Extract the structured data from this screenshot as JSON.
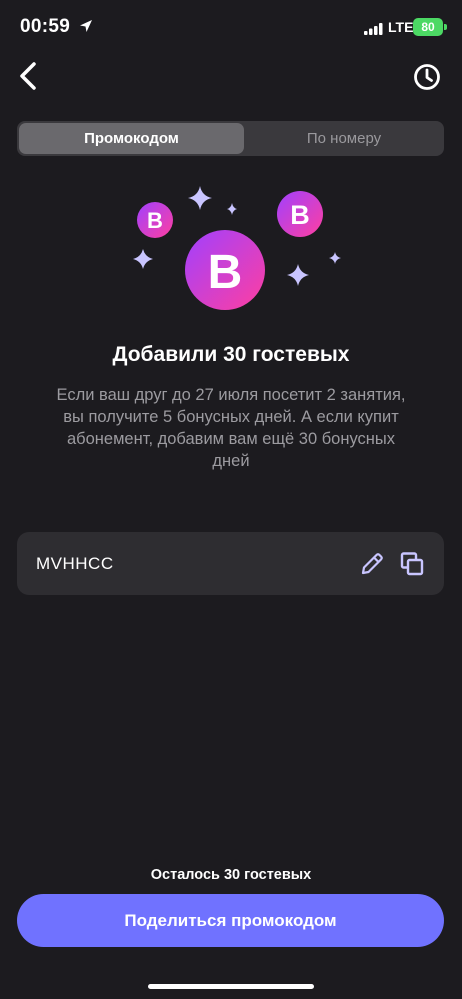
{
  "status_bar": {
    "time": "00:59",
    "network": "LTE",
    "battery": "80"
  },
  "tabs": [
    {
      "label": "Промокодом",
      "active": true
    },
    {
      "label": "По номеру",
      "active": false
    }
  ],
  "hero": {
    "badge_letter": "B"
  },
  "title": "Добавили 30 гостевых",
  "description": "Если ваш друг до 27 июля посетит 2 занятия, вы получите 5 бонусных дней. А если купит абонемент, добавим вам ещё 30 бонусных дней",
  "promo": {
    "code": "MVHHCC"
  },
  "remaining_text": "Осталось 30 гостевых",
  "share_button_label": "Поделиться промокодом",
  "colors": {
    "background": "#1c1b1f",
    "accent": "#7072ff",
    "badge_gradient_start": "#a040ff",
    "badge_gradient_end": "#ff3fa0",
    "sparkle": "#c9c5ff"
  },
  "icons": [
    "location-arrow-icon",
    "signal-icon",
    "battery-icon",
    "back-chevron-icon",
    "history-clock-icon",
    "sparkle-icon",
    "pencil-icon",
    "copy-icon"
  ]
}
